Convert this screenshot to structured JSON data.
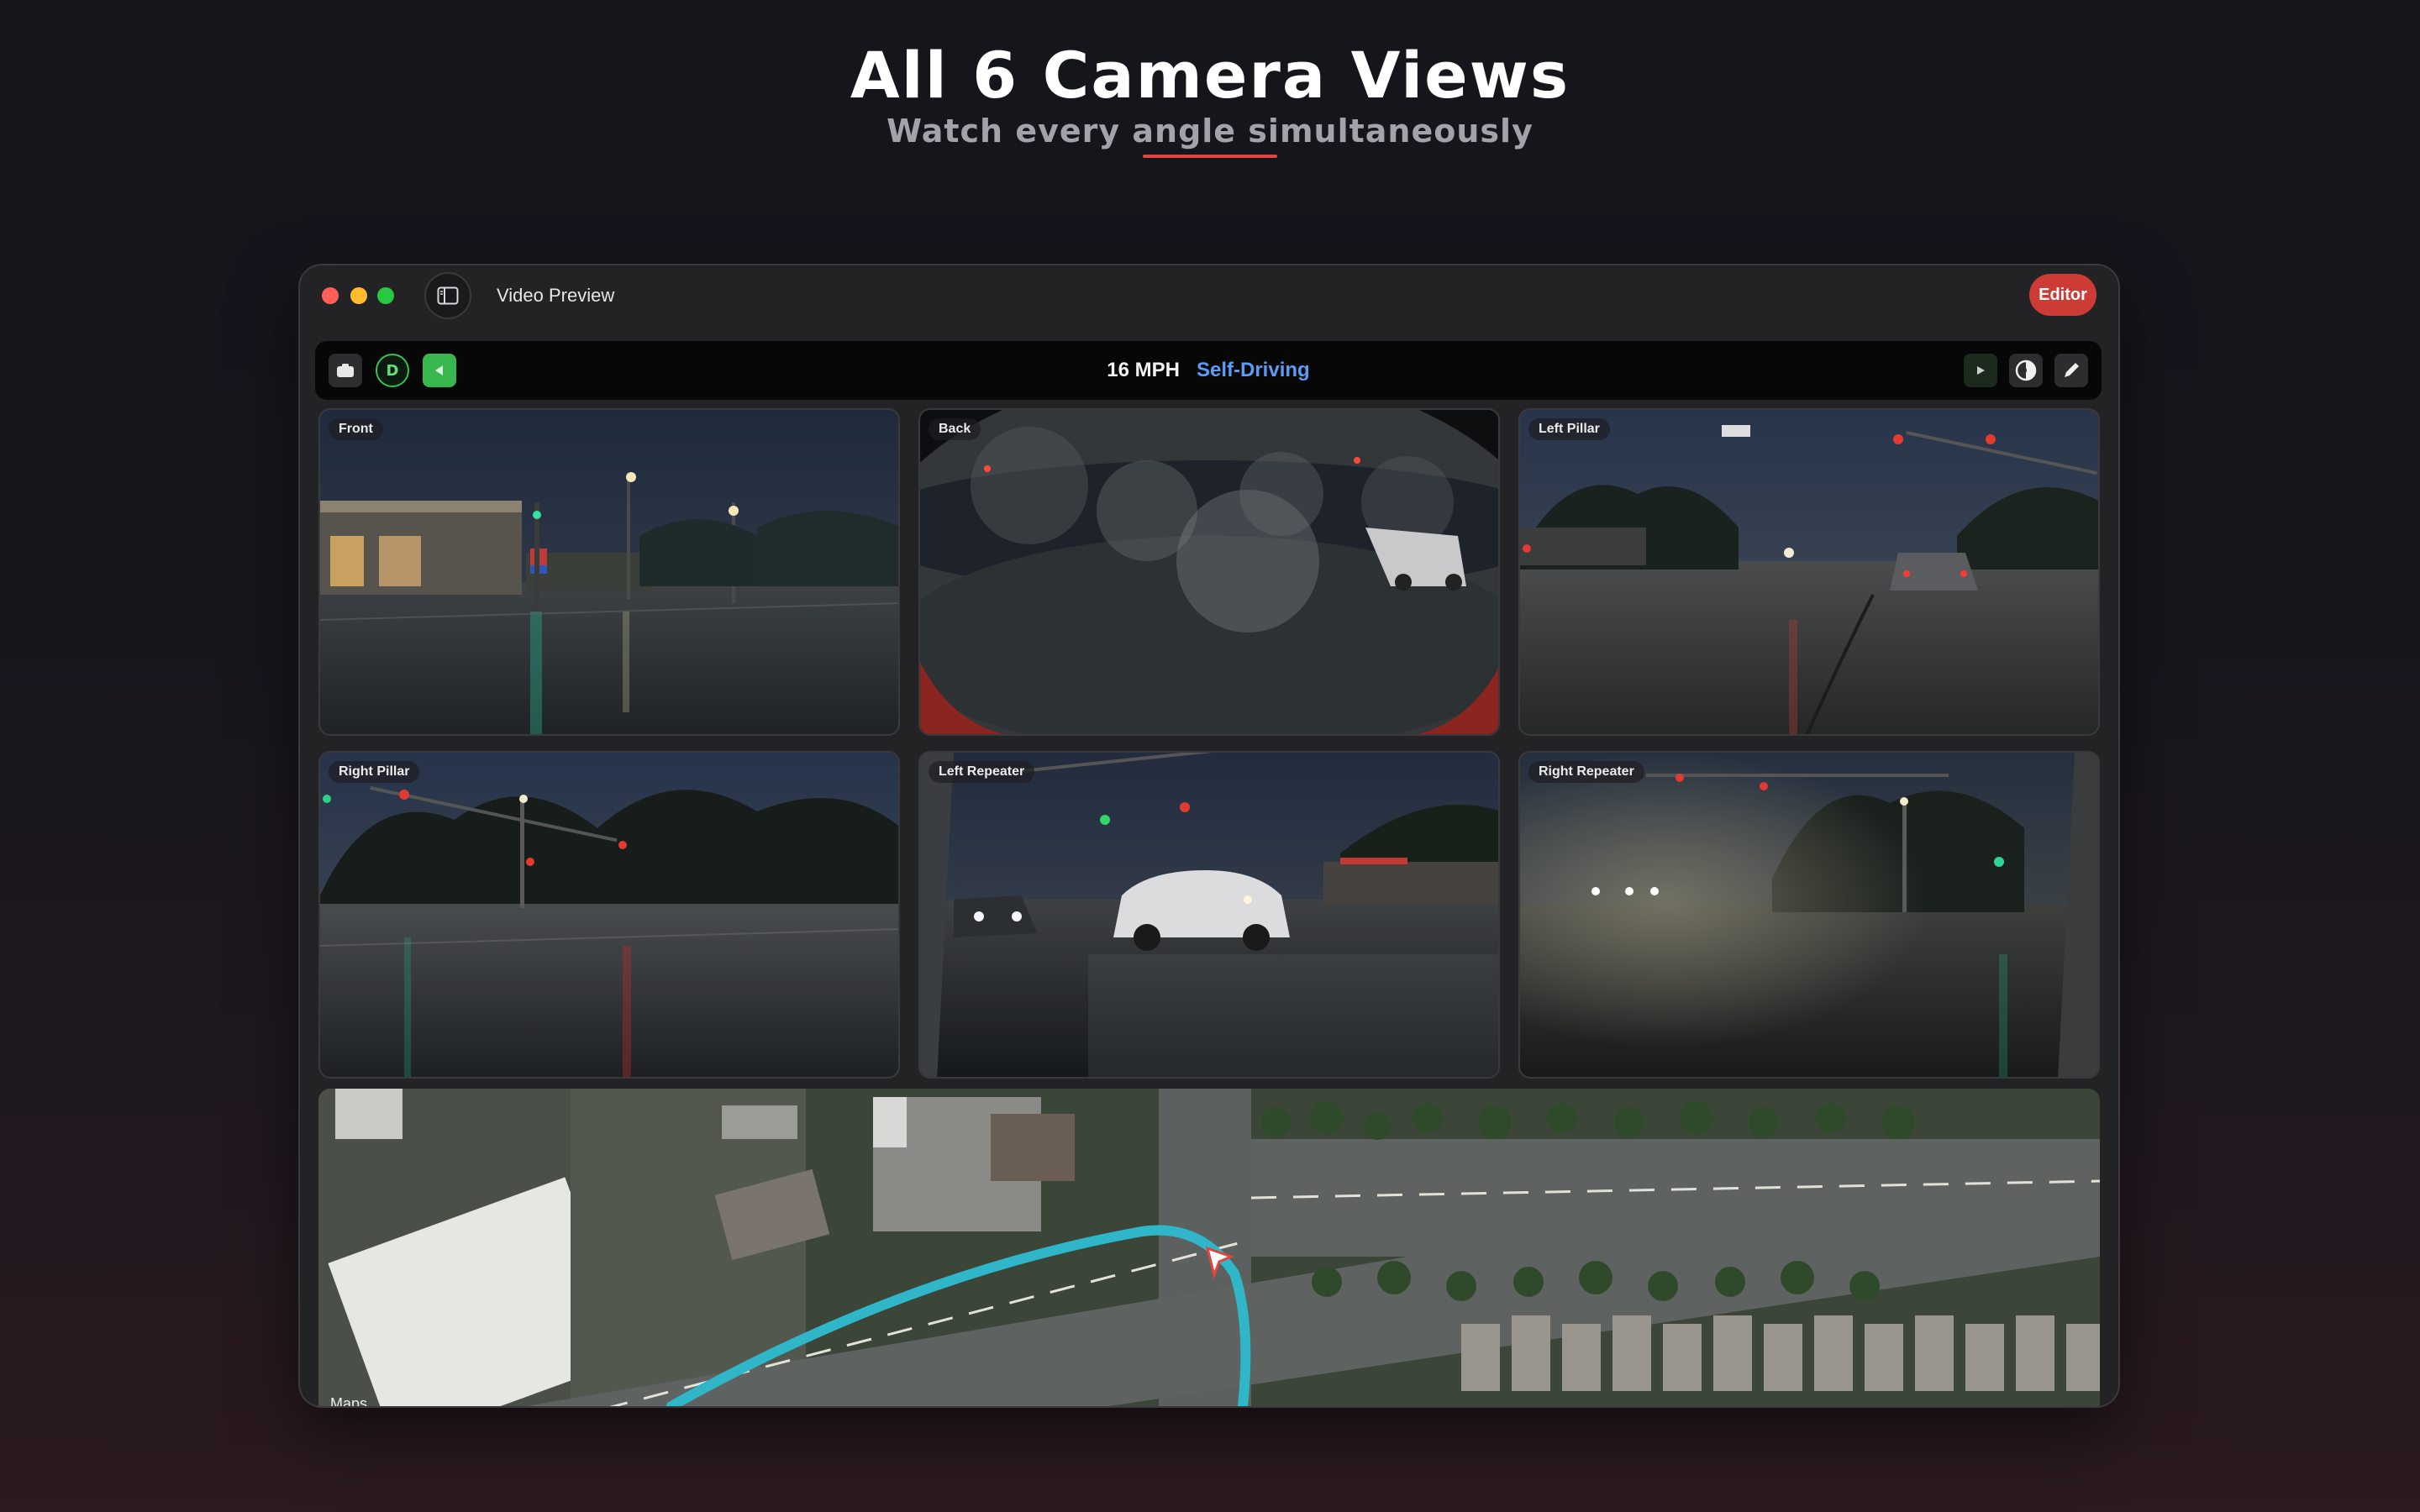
{
  "hero": {
    "title": "All 6 Camera Views",
    "subtitle": "Watch every angle simultaneously"
  },
  "window": {
    "title": "Video Preview",
    "editor_label": "Editor"
  },
  "toolbar": {
    "gear": "D",
    "speed": "16 MPH",
    "mode": "Self-Driving"
  },
  "cameras": [
    {
      "label": "Front"
    },
    {
      "label": "Back"
    },
    {
      "label": "Left Pillar"
    },
    {
      "label": "Right Pillar"
    },
    {
      "label": "Left Repeater"
    },
    {
      "label": "Right Repeater"
    }
  ],
  "map": {
    "attribution": "Maps"
  },
  "colors": {
    "accent_red": "#e0463e",
    "editor_button": "#cc3b34",
    "self_driving_blue": "#5a9cf6",
    "drive_green": "#39b74f",
    "route_cyan": "#2fb6c9"
  },
  "icons": {
    "sidebar_toggle": "sidebar-toggle-icon",
    "camera": "camera-icon",
    "signal": "turn-signal-icon",
    "play": "play-icon",
    "contrast": "contrast-icon",
    "pen": "pen-icon"
  }
}
